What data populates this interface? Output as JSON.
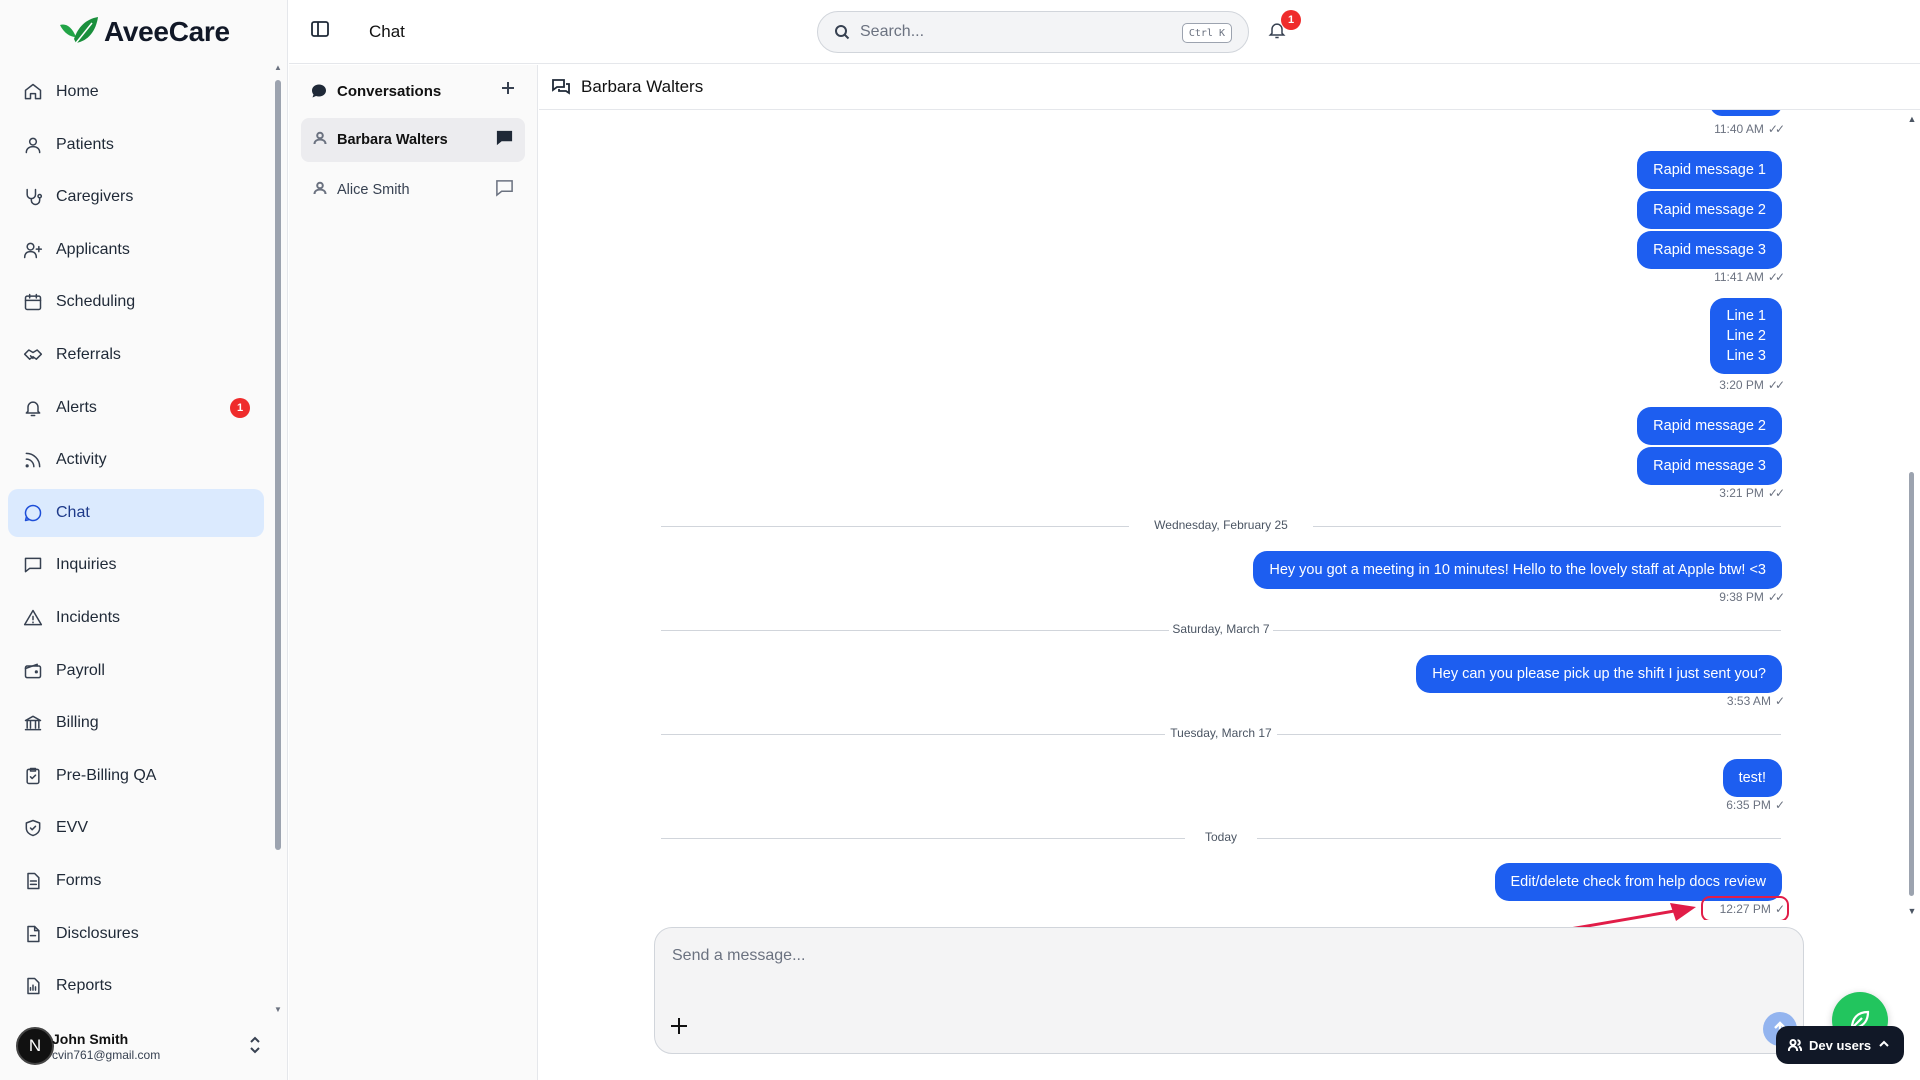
{
  "app": {
    "brand": "AveeCare",
    "brand_color": "#22a447"
  },
  "nav": {
    "items": [
      {
        "label": "Home",
        "icon": "home-icon"
      },
      {
        "label": "Patients",
        "icon": "user-icon"
      },
      {
        "label": "Caregivers",
        "icon": "stethoscope-icon"
      },
      {
        "label": "Applicants",
        "icon": "user-plus-icon"
      },
      {
        "label": "Scheduling",
        "icon": "calendar-icon"
      },
      {
        "label": "Referrals",
        "icon": "handshake-icon"
      },
      {
        "label": "Alerts",
        "icon": "bell-icon",
        "badge": "1"
      },
      {
        "label": "Activity",
        "icon": "rss-icon"
      },
      {
        "label": "Chat",
        "icon": "message-circle-icon",
        "active": true
      },
      {
        "label": "Inquiries",
        "icon": "message-square-icon"
      },
      {
        "label": "Incidents",
        "icon": "alert-triangle-icon"
      },
      {
        "label": "Payroll",
        "icon": "wallet-icon"
      },
      {
        "label": "Billing",
        "icon": "bank-icon"
      },
      {
        "label": "Pre-Billing QA",
        "icon": "clipboard-check-icon"
      },
      {
        "label": "EVV",
        "icon": "shield-check-icon"
      },
      {
        "label": "Forms",
        "icon": "file-text-icon"
      },
      {
        "label": "Disclosures",
        "icon": "file-icon"
      },
      {
        "label": "Reports",
        "icon": "report-icon"
      }
    ]
  },
  "user": {
    "initial": "N",
    "name": "John Smith",
    "email": "cvin761@gmail.com"
  },
  "header": {
    "title": "Chat",
    "search_placeholder": "Search...",
    "search_shortcut": "Ctrl K",
    "notifications_count": "1"
  },
  "conversations": {
    "heading": "Conversations",
    "items": [
      {
        "name": "Barbara Walters",
        "active": true
      },
      {
        "name": "Alice Smith",
        "active": false
      }
    ]
  },
  "chat": {
    "contact": "Barbara Walters",
    "timestamps": {
      "t1": "11:40 AM",
      "t2": "11:41 AM",
      "t3": "3:20 PM",
      "t4": "3:21 PM",
      "t5": "9:38 PM",
      "t6": "3:53 AM",
      "t7": "6:35 PM",
      "t8": "12:27 PM"
    },
    "messages": {
      "m1": "Rapid message 1",
      "m2": "Rapid message 2",
      "m3": "Rapid message 3",
      "m4_line1": "Line 1",
      "m4_line2": "Line 2",
      "m4_line3": "Line 3",
      "m5": "Rapid message 2",
      "m6": "Rapid message 3",
      "m7": "Hey you got a meeting in 10 minutes! Hello to the lovely staff at Apple btw! <3",
      "m8": "Hey can you please pick up the shift I just sent you?",
      "m9": "test!",
      "m10": "Edit/delete check from help docs review"
    },
    "dividers": {
      "d1": "Wednesday, February 25",
      "d2": "Saturday, March 7",
      "d3": "Tuesday, March 17",
      "d4": "Today"
    },
    "read_double": "✓✓",
    "read_single": "✓",
    "bubble_color": "#1d5ef0"
  },
  "composer": {
    "placeholder": "Send a message..."
  },
  "dev": {
    "label": "Dev users"
  },
  "annotation_color": "#e11d48"
}
